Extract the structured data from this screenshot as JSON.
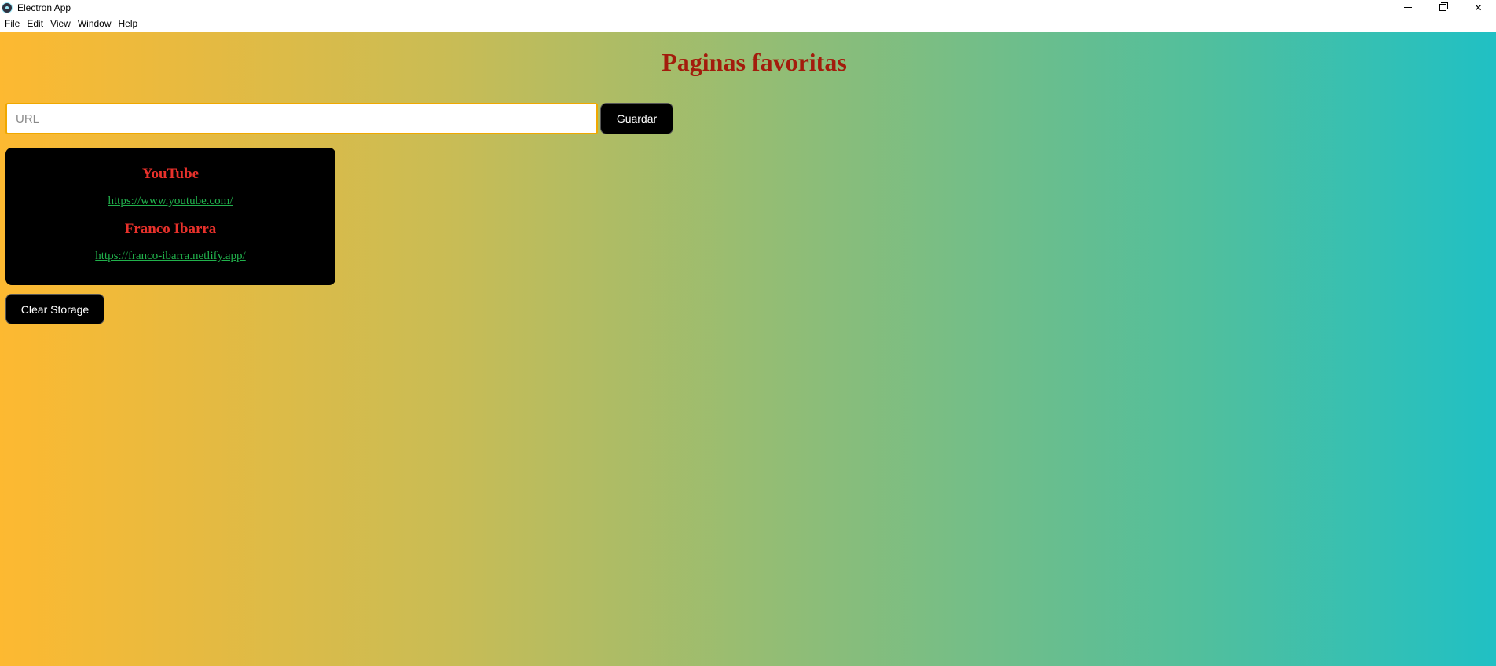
{
  "window": {
    "title": "Electron App",
    "close_glyph": "✕"
  },
  "menubar": {
    "items": [
      "File",
      "Edit",
      "View",
      "Window",
      "Help"
    ]
  },
  "page": {
    "title": "Paginas favoritas",
    "url_input": {
      "placeholder": "URL",
      "value": ""
    },
    "save_button": "Guardar",
    "bookmarks": [
      {
        "title": "YouTube",
        "url": "https://www.youtube.com/"
      },
      {
        "title": "Franco Ibarra",
        "url": "https://franco-ibarra.netlify.app/"
      }
    ],
    "clear_button": "Clear Storage"
  },
  "colors": {
    "title": "#a31c0c",
    "bookmark_title": "#e8312b",
    "bookmark_link": "#21b24c",
    "gradient_start": "#fdb931",
    "gradient_end": "#20c0c4"
  }
}
